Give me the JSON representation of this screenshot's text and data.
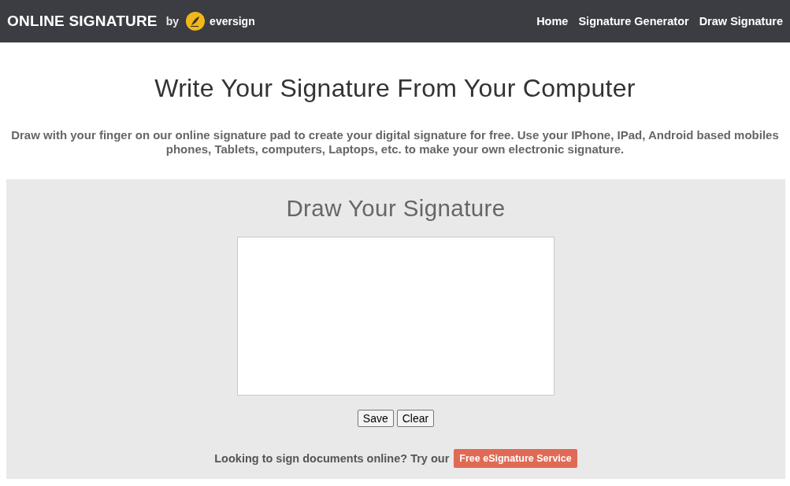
{
  "header": {
    "logo": {
      "brand": "ONLINE SIGNATURE",
      "by": "by",
      "partner": "eversign"
    },
    "nav": [
      {
        "label": "Home"
      },
      {
        "label": "Signature Generator"
      },
      {
        "label": "Draw Signature"
      }
    ]
  },
  "page": {
    "title": "Write Your Signature From Your Computer",
    "intro": "Draw with your finger on our online signature pad to create your digital signature for free. Use your IPhone, IPad, Android based mobiles phones, Tablets, computers, Laptops, etc. to make your own electronic signature."
  },
  "pad_section": {
    "title": "Draw Your Signature",
    "buttons": [
      "Save",
      "Clear"
    ],
    "promo": {
      "text": "Looking to sign documents online? Try our",
      "link": "Free eSignature Service"
    }
  }
}
